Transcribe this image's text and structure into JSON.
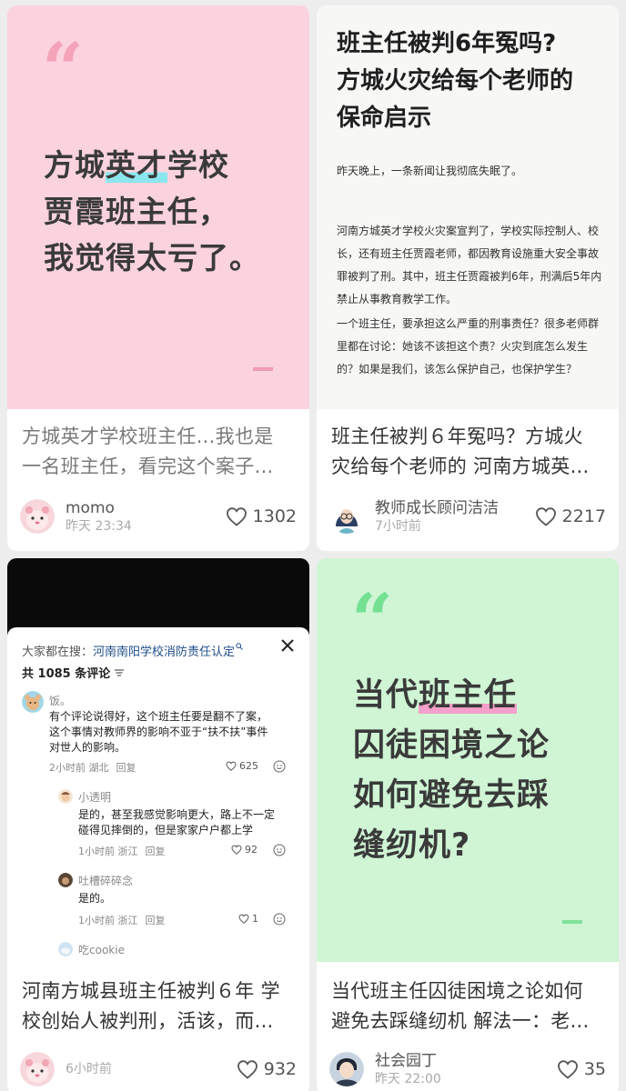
{
  "colors": {
    "card1_bg": "#fad3de",
    "card4_bg": "#cff5d4",
    "cyan_highlight": "#8be6ee",
    "pink_highlight": "#f59fcb"
  },
  "cards": [
    {
      "cover": {
        "quote": "“",
        "lines": [
          "方城",
          "英才",
          "学校",
          "贾霞班主任，",
          "我觉得太亏了。"
        ]
      },
      "title_line1": "方城英才学校班主任...我也是",
      "title_line2": "一名班主任，看完这个案子...",
      "author": "momo",
      "time": "昨天 23:34",
      "likes": "1302"
    },
    {
      "cover": {
        "headline_lines": [
          "班主任被判6年冤吗?",
          "方城火灾给每个老师的",
          "保命启示"
        ],
        "para1": "昨天晚上，一条新闻让我彻底失眠了。",
        "para2": "河南方城英才学校火灾案宣判了，学校实际控制人、校长，还有班主任贾霞老师，都因教育设施重大安全事故罪被判了刑。其中，班主任贾霞被判6年，刑满后5年内禁止从事教育教学工作。",
        "para3": "一个班主任，要承担这么严重的刑事责任？很多老师群里都在讨论：她该不该担这个责？火灾到底怎么发生的？如果是我们，该怎么保护自己，也保护学生？"
      },
      "title_line1": "班主任被判６年冤吗？方城火",
      "title_line2": "灾给每个老师的 河南方城英...",
      "author": "教师成长顾问洁洁",
      "time": "7小时前",
      "likes": "2217"
    },
    {
      "cover": {
        "search_prefix": "大家都在搜：",
        "search_key": "河南南阳学校消防责任认定",
        "comment_count": "共 1085 条评论",
        "comments": [
          {
            "name": "饭。",
            "text_lines": [
              "有个评论说得好，这个班主任要是翻不了案，",
              "这个事情对教师界的影响不亚于“扶不扶”事件",
              "对世人的影响。"
            ],
            "meta": "2小时前 湖北",
            "reply": "回复",
            "likes": "625"
          },
          {
            "name": "小透明",
            "text_lines": [
              "是的，甚至我感觉影响更大，路上不一定",
              "碰得见摔倒的，但是家家户户都上学"
            ],
            "meta": "1小时前 浙江",
            "reply": "回复",
            "likes": "92"
          },
          {
            "name": "吐槽碎碎念",
            "text_lines": [
              "是的。"
            ],
            "meta": "1小时前 浙江",
            "reply": "回复",
            "likes": "1"
          },
          {
            "name": "吃cookie"
          }
        ]
      },
      "title_line1": "河南方城县班主任被判６年 学",
      "title_line2": "校创始人被判刑，活该，而...",
      "author": "",
      "time": "6小时前",
      "likes": "932"
    },
    {
      "cover": {
        "quote": "“",
        "lines": [
          "当代",
          "班主任",
          "囚徒困境之论",
          "如何避免去踩",
          "缝纫机?"
        ]
      },
      "title_line1": "当代班主任囚徒困境之论如何",
      "title_line2": "避免去踩缝纫机 解法一：老...",
      "author": "社会园丁",
      "time": "昨天 22:00",
      "likes": "35"
    }
  ]
}
